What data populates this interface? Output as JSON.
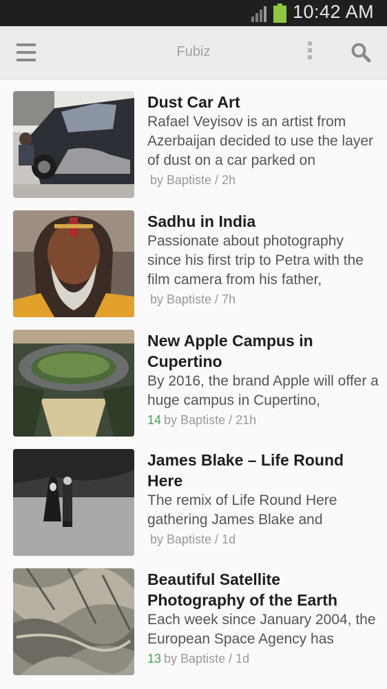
{
  "status_bar": {
    "time": "10:42 AM",
    "battery_color": "#8ec63f"
  },
  "action_bar": {
    "title": "Fubiz"
  },
  "articles": [
    {
      "title": "Dust Car Art",
      "excerpt": "Rafael Veyisov is an artist from Azerbaijan decided to use the layer of dust on a car parked on",
      "count": "",
      "author_line": "by Baptiste / 2h"
    },
    {
      "title": "Sadhu in India",
      "excerpt": "Passionate about photography since his first trip to Petra with the film camera from his father,",
      "count": "",
      "author_line": "by Baptiste / 7h"
    },
    {
      "title": "New Apple Campus in Cupertino",
      "excerpt": "By 2016, the brand Apple will offer a huge campus in Cupertino,",
      "count": "14",
      "author_line": "by Baptiste / 21h"
    },
    {
      "title": "James Blake – Life Round Here",
      "excerpt": "The remix of Life Round Here gathering James Blake and",
      "count": "",
      "author_line": "by Baptiste / 1d"
    },
    {
      "title": "Beautiful Satellite Photography of the Earth",
      "excerpt": "Each week since January 2004, the European Space Agency has",
      "count": "13",
      "author_line": "by Baptiste / 1d"
    }
  ],
  "colors": {
    "accent_count": "#3ea84a",
    "action_bar_bg": "#ececec",
    "status_bar_bg": "#1f1f1f"
  },
  "icons": [
    "signal-icon",
    "battery-icon",
    "menu-icon",
    "overflow-menu-icon",
    "search-icon"
  ]
}
